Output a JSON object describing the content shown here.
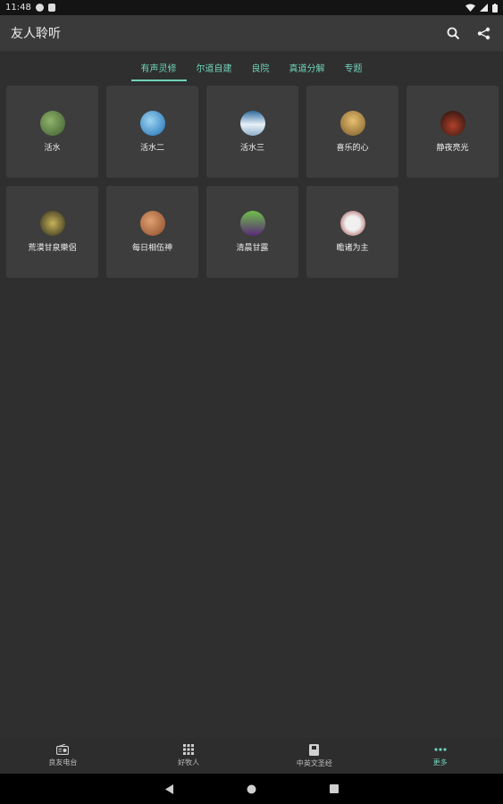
{
  "status_bar": {
    "time": "11:48"
  },
  "app_bar": {
    "title": "友人聆听"
  },
  "tabs": [
    {
      "label": "有声灵修",
      "active": true
    },
    {
      "label": "尔道自建",
      "active": false
    },
    {
      "label": "良院",
      "active": false
    },
    {
      "label": "真道分解",
      "active": false
    },
    {
      "label": "专题",
      "active": false
    }
  ],
  "cards": [
    {
      "label": "活水",
      "avatar_colors": [
        "#3e5b2f",
        "#8fb36b"
      ]
    },
    {
      "label": "活水二",
      "avatar_colors": [
        "#1b6fb3",
        "#9fd4f2"
      ]
    },
    {
      "label": "活水三",
      "avatar_colors": [
        "#e8f0f8",
        "#2e6a9e"
      ]
    },
    {
      "label": "喜乐的心",
      "avatar_colors": [
        "#7a5a2a",
        "#e8c070"
      ]
    },
    {
      "label": "静夜亮光",
      "avatar_colors": [
        "#1a0f0c",
        "#b0402a"
      ]
    },
    {
      "label": "荒漠甘泉樂侶",
      "avatar_colors": [
        "#2b2b1a",
        "#c8b25a"
      ]
    },
    {
      "label": "每日相伍神",
      "avatar_colors": [
        "#8a4a2a",
        "#e0a070"
      ]
    },
    {
      "label": "清晨甘露",
      "avatar_colors": [
        "#5a2a7a",
        "#6fbf4a"
      ]
    },
    {
      "label": "瞻诸为主",
      "avatar_colors": [
        "#f0f0f0",
        "#9a3a3a"
      ]
    }
  ],
  "bottom_nav": [
    {
      "label": "良友电台",
      "icon": "radio-icon",
      "active": false
    },
    {
      "label": "好牧人",
      "icon": "grid-icon",
      "active": false
    },
    {
      "label": "中英文圣经",
      "icon": "book-icon",
      "active": false
    },
    {
      "label": "更多",
      "icon": "more-icon",
      "active": true
    }
  ],
  "colors": {
    "accent": "#6fd3b9",
    "background": "#2f2f2f",
    "card": "#3d3d3d",
    "app_bar": "#3a3a3a"
  }
}
